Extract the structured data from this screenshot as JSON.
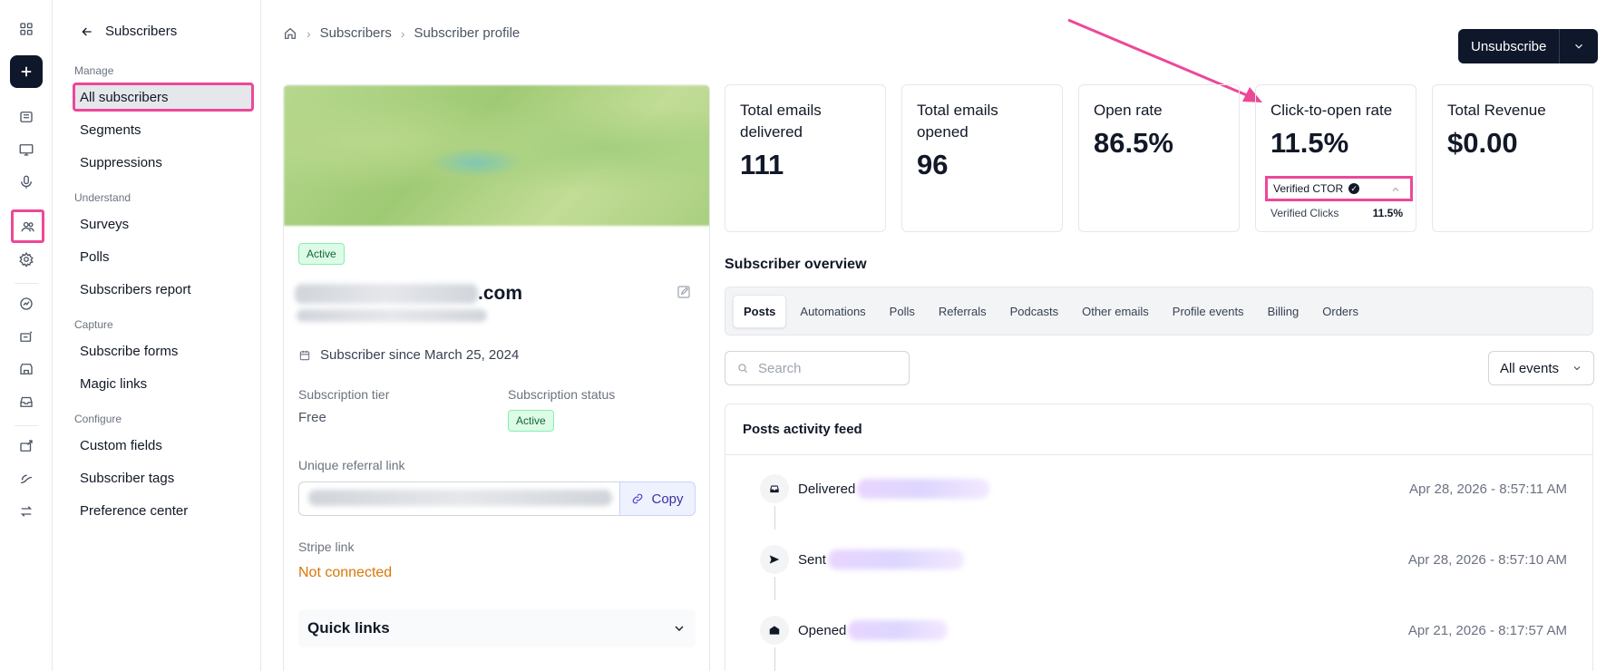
{
  "nav": {
    "back_label": "Subscribers",
    "groups": {
      "manage": "Manage",
      "understand": "Understand",
      "capture": "Capture",
      "configure": "Configure"
    },
    "items": {
      "all_subscribers": "All subscribers",
      "segments": "Segments",
      "suppressions": "Suppressions",
      "surveys": "Surveys",
      "polls": "Polls",
      "subscribers_report": "Subscribers report",
      "subscribe_forms": "Subscribe forms",
      "magic_links": "Magic links",
      "custom_fields": "Custom fields",
      "subscriber_tags": "Subscriber tags",
      "preference_center": "Preference center"
    }
  },
  "breadcrumb": [
    "Subscribers",
    "Subscriber profile"
  ],
  "actions": {
    "unsubscribe": "Unsubscribe"
  },
  "profile": {
    "status_badge": "Active",
    "email_suffix": ".com",
    "since": "Subscriber since March 25, 2024",
    "tier_label": "Subscription tier",
    "tier_value": "Free",
    "status_label": "Subscription status",
    "status_value": "Active",
    "referral_label": "Unique referral link",
    "copy_label": "Copy",
    "stripe_label": "Stripe link",
    "stripe_value": "Not connected",
    "quick_links": "Quick links"
  },
  "stats": [
    {
      "title": "Total emails delivered",
      "value": "111"
    },
    {
      "title": "Total emails opened",
      "value": "96"
    },
    {
      "title": "Open rate",
      "value": "86.5%"
    },
    {
      "title": "Click-to-open rate",
      "value": "11.5%"
    },
    {
      "title": "Total Revenue",
      "value": "$0.00"
    }
  ],
  "ctor": {
    "verified_label": "Verified CTOR",
    "clicks_label": "Verified Clicks",
    "clicks_value": "11.5%"
  },
  "overview": {
    "title": "Subscriber overview",
    "tabs": [
      "Posts",
      "Automations",
      "Polls",
      "Referrals",
      "Podcasts",
      "Other emails",
      "Profile events",
      "Billing",
      "Orders"
    ],
    "search_placeholder": "Search",
    "filter_value": "All events",
    "feed_title": "Posts activity feed",
    "events": [
      {
        "label": "Delivered",
        "time": "Apr 28, 2026 - 8:57:11 AM"
      },
      {
        "label": "Sent",
        "time": "Apr 28, 2026 - 8:57:10 AM"
      },
      {
        "label": "Opened",
        "time": "Apr 21, 2026 - 8:17:57 AM"
      }
    ]
  },
  "colors": {
    "highlight": "#ec4899",
    "primary": "#0f172a",
    "warning": "#d97706"
  }
}
